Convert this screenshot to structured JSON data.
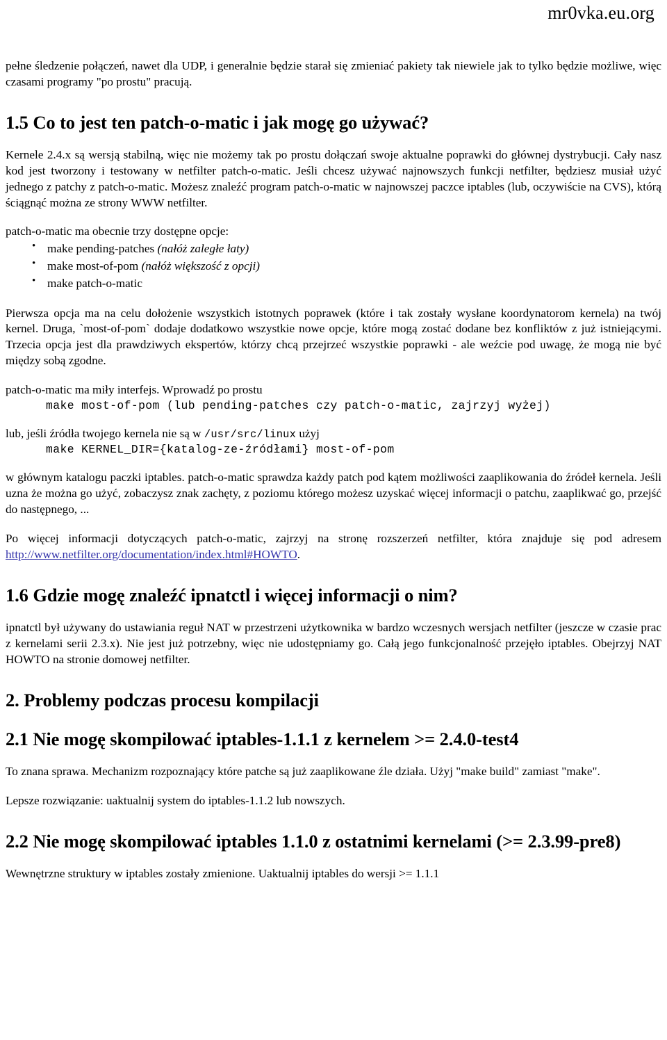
{
  "header": {
    "site": "mr0vka.eu.org"
  },
  "content": {
    "intro_paragraph": "pełne śledzenie połączeń, nawet dla UDP, i generalnie będzie starał się zmieniać pakiety tak niewiele jak to tylko będzie możliwe, więc czasami programy \"po prostu\" pracują.",
    "heading_1_5": "1.5 Co to jest ten patch-o-matic i jak mogę go używać?",
    "paragraph_kernele": "Kernele 2.4.x są wersją stabilną, więc nie możemy tak po prostu dołączań swoje aktualne poprawki do głównej dystrybucji. Cały nasz kod jest tworzony i testowany w netfilter patch-o-matic. Jeśli chcesz używać najnowszych funkcji netfilter, będziesz musiał użyć jednego z patchy z patch-o-matic. Możesz znaleźć program patch-o-matic w najnowszej paczce iptables (lub, oczywiście na CVS), którą ściągnąć można ze strony WWW netfilter.",
    "paragraph_opcje_intro": "patch-o-matic ma obecnie trzy dostępne opcje:",
    "options": [
      {
        "command": "make pending-patches",
        "note": "(nałóż zaległe łaty)"
      },
      {
        "command": "make most-of-pom",
        "note": "(nałóż większość z opcji)"
      },
      {
        "command": "make patch-o-matic",
        "note": ""
      }
    ],
    "paragraph_pierwsza": "Pierwsza opcja ma na celu dołożenie wszystkich istotnych poprawek (które i tak zostały wysłane koordynatorom kernela) na twój kernel. Druga, `most-of-pom` dodaje dodatkowo wszystkie nowe opcje, które mogą zostać dodane bez konfliktów z już istniejącymi. Trzecia opcja jest dla prawdziwych ekspertów, którzy chcą przejrzeć wszystkie poprawki - ale weźcie pod uwagę, że mogą nie być między sobą zgodne.",
    "paragraph_interfejs": "patch-o-matic ma miły interfejs. Wprowadź po prostu",
    "code_1": "make most-of-pom (lub pending-patches czy patch-o-matic, zajrzyj wyżej)",
    "paragraph_lub_zrodla_pre": "lub, jeśli źródła twojego kernela nie są w ",
    "paragraph_lub_zrodla_path": "/usr/src/linux",
    "paragraph_lub_zrodla_post": " użyj",
    "code_2": "make KERNEL_DIR={katalog-ze-źródłami} most-of-pom",
    "paragraph_glowny_katalog": "w głównym katalogu paczki iptables. patch-o-matic sprawdza każdy patch pod kątem możliwości zaaplikowania do źródeł kernela. Jeśli uzna że można go użyć, zobaczysz znak zachęty, z poziomu którego możesz uzyskać więcej informacji o patchu, zaaplikwać go, przejść do następnego, ...",
    "paragraph_po_wiecej_pre": "Po więcej informacji dotyczących patch-o-matic, zajrzyj na stronę rozszerzeń netfilter, która znajduje się pod adresem ",
    "link_url": "http://www.netfilter.org/documentation/index.html#HOWTO",
    "paragraph_po_wiecej_post": ".",
    "heading_1_6": "1.6 Gdzie mogę znaleźć ipnatctl i więcej informacji o nim?",
    "paragraph_ipnatctl": "ipnatctl był używany do ustawiania reguł NAT w przestrzeni użytkownika w bardzo wczesnych wersjach netfilter (jeszcze w czasie prac z kernelami serii 2.3.x). Nie jest już potrzebny, więc nie udostępniamy go. Całą jego funkcjonalność przejęło iptables. Obejrzyj NAT HOWTO na stronie domowej netfilter.",
    "heading_2": "2. Problemy podczas procesu kompilacji",
    "heading_2_1": "2.1 Nie mogę skompilować iptables-1.1.1 z kernelem >= 2.4.0-test4",
    "paragraph_znana_sprawa": "To znana sprawa. Mechanizm rozpoznający które patche są już zaaplikowane źle działa. Użyj \"make build\" zamiast \"make\".",
    "paragraph_lepsze": "Lepsze rozwiązanie: uaktualnij system do iptables-1.1.2 lub nowszych.",
    "heading_2_2": "2.2 Nie mogę skompilować iptables 1.1.0 z ostatnimi kernelami (>= 2.3.99-pre8)",
    "paragraph_wewnetrzne": "Wewnętrzne struktury w iptables zostały zmienione. Uaktualnij iptables do wersji >= 1.1.1"
  },
  "colors": {
    "link": "#3333aa",
    "text": "#000000",
    "background": "#ffffff"
  }
}
